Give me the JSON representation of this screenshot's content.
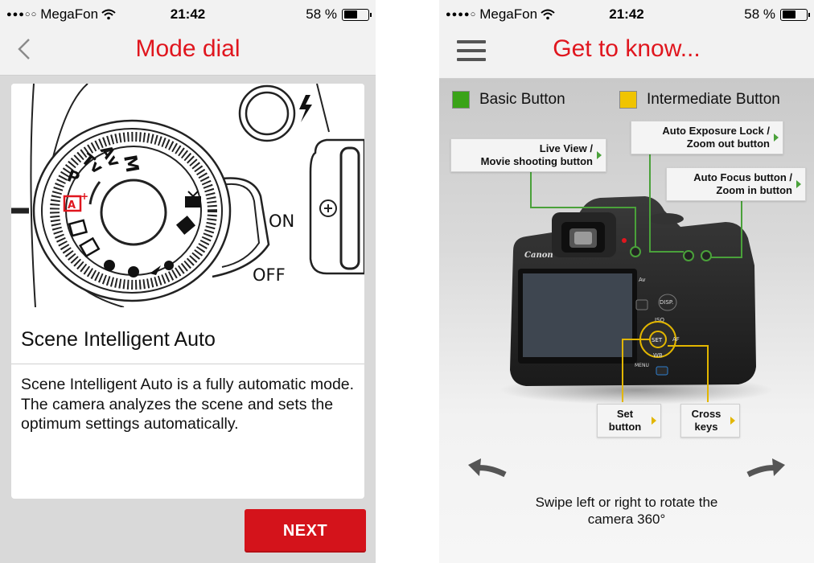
{
  "left": {
    "status": {
      "carrier": "MegaFon",
      "signal": "●●●○○",
      "time": "21:42",
      "battery": "58 %",
      "battery_level": 0.58
    },
    "nav": {
      "title": "Mode dial",
      "back_icon": "chevron-left-icon"
    },
    "dial_labels": {
      "m": "M",
      "av": "Av",
      "tv": "Tv",
      "p": "P",
      "on": "ON",
      "off": "OFF"
    },
    "mode": {
      "title": "Scene Intelligent Auto",
      "description": "Scene Intelligent Auto is a fully automatic mode. The camera analyzes the scene and sets the optimum settings automatically."
    },
    "next_label": "NEXT"
  },
  "right": {
    "status": {
      "carrier": "MegaFon",
      "signal": "●●●●○",
      "time": "21:42",
      "battery": "58 %",
      "battery_level": 0.58
    },
    "nav": {
      "title": "Get to know...",
      "menu_icon": "hamburger-menu-icon"
    },
    "legend": [
      {
        "label": "Basic Button",
        "color": "#3aa318"
      },
      {
        "label": "Intermediate Button",
        "color": "#f0c400"
      }
    ],
    "callouts": {
      "live_view": [
        "Live View /",
        "Movie shooting button"
      ],
      "ae_lock": [
        "Auto Exposure Lock /",
        "Zoom out button"
      ],
      "af": [
        "Auto Focus button /",
        "Zoom in button"
      ],
      "set": [
        "Set",
        "button"
      ],
      "cross": [
        "Cross",
        "keys"
      ]
    },
    "camera_labels": {
      "brand": "Canon",
      "av": "Av",
      "disp": "DISP.",
      "iso": "ISO",
      "set": "SET",
      "af": "AF",
      "wb": "WB",
      "menu": "MENU"
    },
    "swipe_text": [
      "Swipe left or right to rotate the",
      "camera 360°"
    ],
    "colors": {
      "accent": "#e0161e",
      "button_red": "#d4131b",
      "green_line": "#4aa13a",
      "yellow_line": "#e2b600"
    }
  }
}
